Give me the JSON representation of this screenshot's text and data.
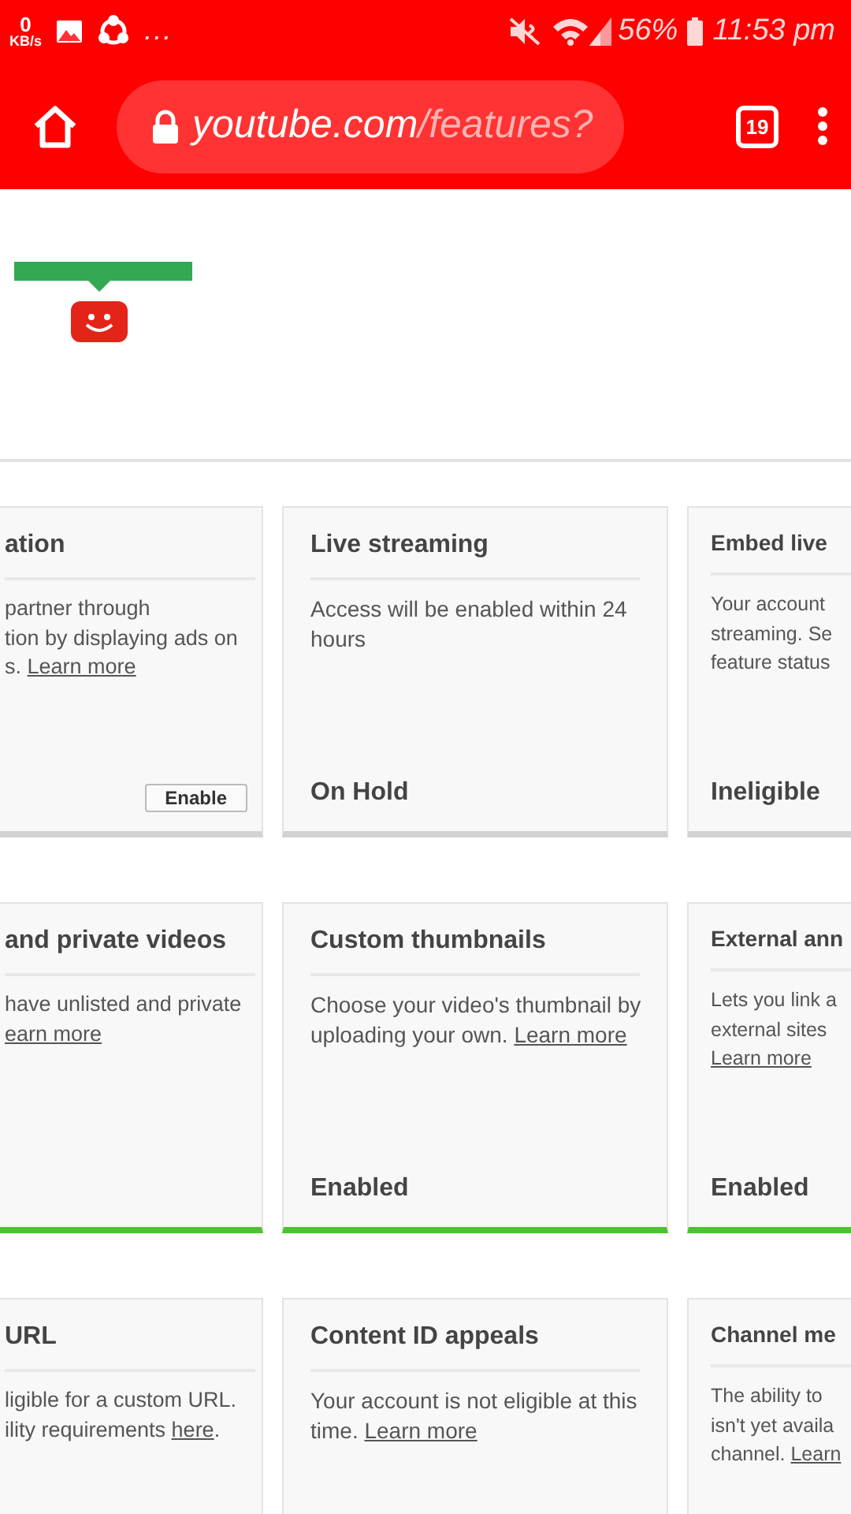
{
  "status_bar": {
    "speed_value": "0",
    "speed_unit": "KB/s",
    "more": "…",
    "battery": "56%",
    "time": "11:53 pm"
  },
  "toolbar": {
    "url_host": "youtube.com",
    "url_path": "/features?",
    "tab_count": "19"
  },
  "cards": [
    {
      "title": "ation",
      "description": [
        {
          "kind": "text",
          "text": "partner through\ntion by displaying ads on\ns. "
        },
        {
          "kind": "link",
          "text": "Learn more"
        }
      ],
      "button": "Enable",
      "enabled": false
    },
    {
      "title": "Live streaming",
      "description": [
        {
          "kind": "text",
          "text": "Access will be enabled within 24\nhours"
        }
      ],
      "status": "On Hold",
      "enabled": false
    },
    {
      "title": "Embed live",
      "description": [
        {
          "kind": "text",
          "text": "Your account\nstreaming. Se\nfeature status"
        }
      ],
      "status": "Ineligible",
      "enabled": false
    },
    {
      "title": "and private videos",
      "description": [
        {
          "kind": "text",
          "text": "have unlisted and private\n"
        },
        {
          "kind": "link",
          "text": "earn more"
        }
      ],
      "enabled": true
    },
    {
      "title": "Custom thumbnails",
      "description": [
        {
          "kind": "text",
          "text": "Choose your video's thumbnail by\nuploading your own. "
        },
        {
          "kind": "link",
          "text": "Learn more"
        }
      ],
      "status": "Enabled",
      "enabled": true
    },
    {
      "title": "External ann",
      "description": [
        {
          "kind": "text",
          "text": "Lets you link a\nexternal sites\n"
        },
        {
          "kind": "link",
          "text": "Learn more"
        }
      ],
      "status": "Enabled",
      "enabled": true
    },
    {
      "title": "URL",
      "description": [
        {
          "kind": "text",
          "text": "ligible for a custom URL.\nility requirements "
        },
        {
          "kind": "link",
          "text": "here"
        },
        {
          "kind": "text",
          "text": "."
        }
      ]
    },
    {
      "title": "Content ID appeals",
      "description": [
        {
          "kind": "text",
          "text": "Your account is not eligible at this\ntime. "
        },
        {
          "kind": "link",
          "text": "Learn more"
        }
      ]
    },
    {
      "title": "Channel me",
      "description": [
        {
          "kind": "text",
          "text": "The ability to\nisn't yet availa\nchannel. "
        },
        {
          "kind": "link",
          "text": "Learn"
        }
      ]
    }
  ]
}
